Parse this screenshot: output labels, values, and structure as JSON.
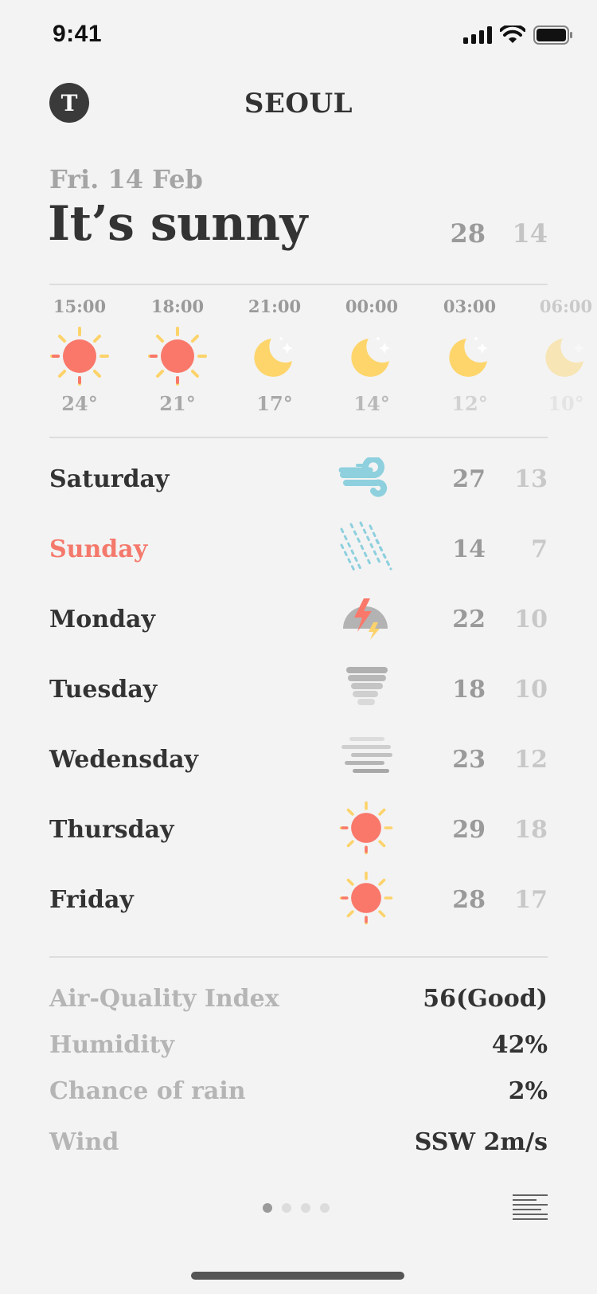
{
  "status": {
    "time": "9:41"
  },
  "header": {
    "avatar_letter": "T",
    "city": "SEOUL"
  },
  "today": {
    "date": "Fri. 14 Feb",
    "headline": "It’s sunny",
    "high": "28",
    "low": "14"
  },
  "hourly": [
    {
      "time": "15:00",
      "icon": "sun-icon",
      "temp": "24°"
    },
    {
      "time": "18:00",
      "icon": "sun-icon",
      "temp": "21°"
    },
    {
      "time": "21:00",
      "icon": "moon-icon",
      "temp": "17°"
    },
    {
      "time": "00:00",
      "icon": "moon-icon",
      "temp": "14°"
    },
    {
      "time": "03:00",
      "icon": "moon-icon",
      "temp": "12°"
    },
    {
      "time": "06:00",
      "icon": "moon-icon",
      "temp": "10°"
    }
  ],
  "daily": [
    {
      "day": "Saturday",
      "icon": "wind-icon",
      "high": "27",
      "low": "13"
    },
    {
      "day": "Sunday",
      "icon": "rain-icon",
      "high": "14",
      "low": "7"
    },
    {
      "day": "Monday",
      "icon": "thunderstorm-icon",
      "high": "22",
      "low": "10"
    },
    {
      "day": "Tuesday",
      "icon": "tornado-icon",
      "high": "18",
      "low": "10"
    },
    {
      "day": "Wedensday",
      "icon": "fog-icon",
      "high": "23",
      "low": "12"
    },
    {
      "day": "Thursday",
      "icon": "sun-icon",
      "high": "29",
      "low": "18"
    },
    {
      "day": "Friday",
      "icon": "sun-icon",
      "high": "28",
      "low": "17"
    }
  ],
  "details": [
    {
      "label": "Air-Quality Index",
      "value": "56(Good)"
    },
    {
      "label": "Humidity",
      "value": "42%"
    },
    {
      "label": "Chance of rain",
      "value": "2%"
    },
    {
      "label": "Wind",
      "value": "SSW 2m/s"
    }
  ],
  "pager": {
    "count": 4,
    "active": 0
  },
  "colors": {
    "accent": "#f4796c",
    "sun": "#f9786a",
    "ray": "#fcd36a",
    "moon": "#fdd56b",
    "wind": "#8ed0de"
  }
}
